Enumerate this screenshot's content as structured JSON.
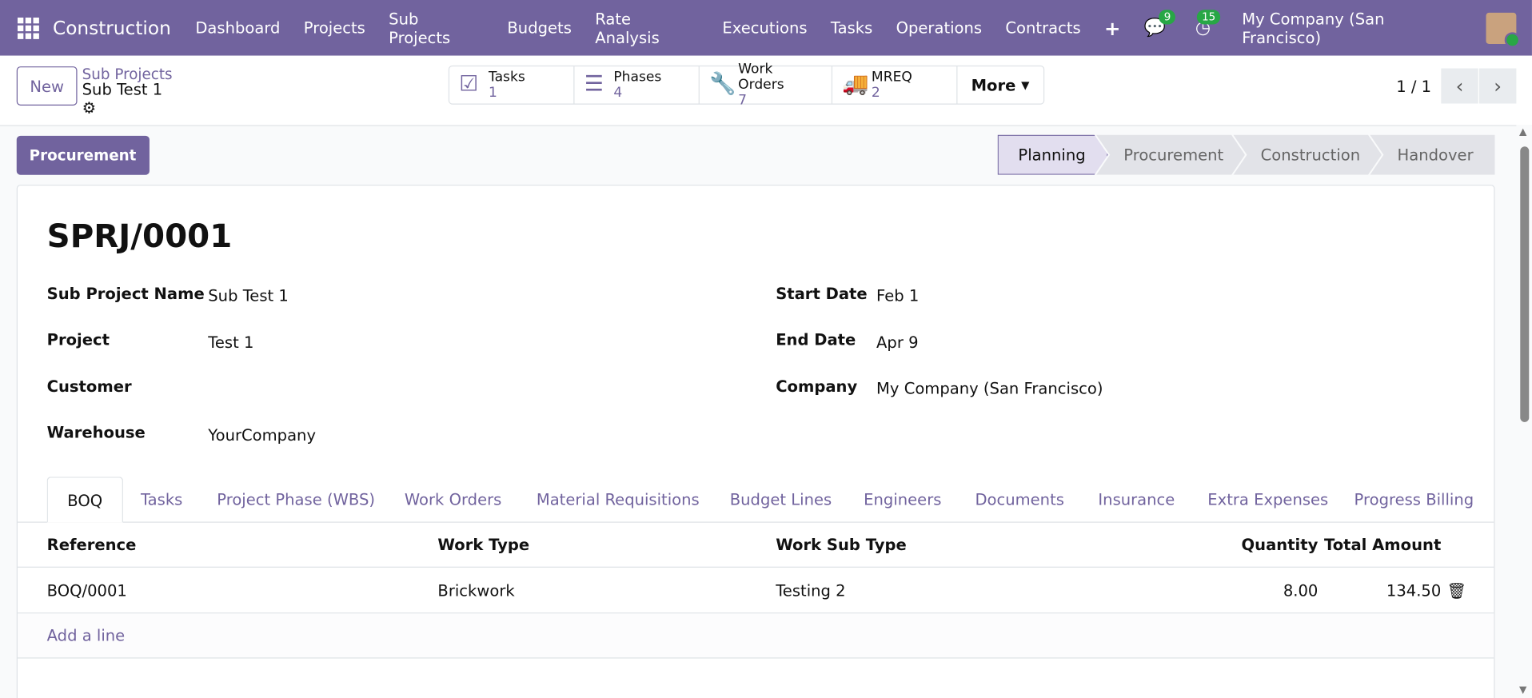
{
  "nav": {
    "app": "Construction",
    "items": [
      "Dashboard",
      "Projects",
      "Sub Projects",
      "Budgets",
      "Rate Analysis",
      "Executions",
      "Tasks",
      "Operations",
      "Contracts"
    ],
    "messages_count": "9",
    "activities_count": "15",
    "company": "My Company (San Francisco)"
  },
  "control": {
    "new": "New",
    "breadcrumb_parent": "Sub Projects",
    "breadcrumb_current": "Sub Test 1",
    "smart_buttons": [
      {
        "label": "Tasks",
        "value": "1"
      },
      {
        "label": "Phases",
        "value": "4"
      },
      {
        "label": "Work Orders",
        "value": "7"
      },
      {
        "label": "MREQ",
        "value": "2"
      }
    ],
    "more": "More",
    "pager": "1 / 1"
  },
  "status": {
    "action_button": "Procurement",
    "stages": [
      "Planning",
      "Procurement",
      "Construction",
      "Handover"
    ],
    "current": "Planning"
  },
  "form": {
    "title": "SPRJ/0001",
    "left": [
      {
        "label": "Sub Project Name",
        "value": "Sub Test 1"
      },
      {
        "label": "Project",
        "value": "Test 1"
      },
      {
        "label": "Customer",
        "value": ""
      },
      {
        "label": "Warehouse",
        "value": "YourCompany"
      }
    ],
    "right": [
      {
        "label": "Start Date",
        "value": "Feb 1"
      },
      {
        "label": "End Date",
        "value": "Apr 9"
      },
      {
        "label": "Company",
        "value": "My Company (San Francisco)"
      }
    ]
  },
  "tabs": [
    "BOQ",
    "Tasks",
    "Project Phase (WBS)",
    "Work Orders",
    "Material Requisitions",
    "Budget Lines",
    "Engineers",
    "Documents",
    "Insurance",
    "Extra Expenses",
    "Progress Billing"
  ],
  "table": {
    "headers": [
      "Reference",
      "Work Type",
      "Work Sub Type",
      "Quantity",
      "Total Amount"
    ],
    "rows": [
      {
        "reference": "BOQ/0001",
        "work_type": "Brickwork",
        "work_sub_type": "Testing 2",
        "quantity": "8.00",
        "total": "134.50"
      }
    ],
    "add_line": "Add a line"
  }
}
